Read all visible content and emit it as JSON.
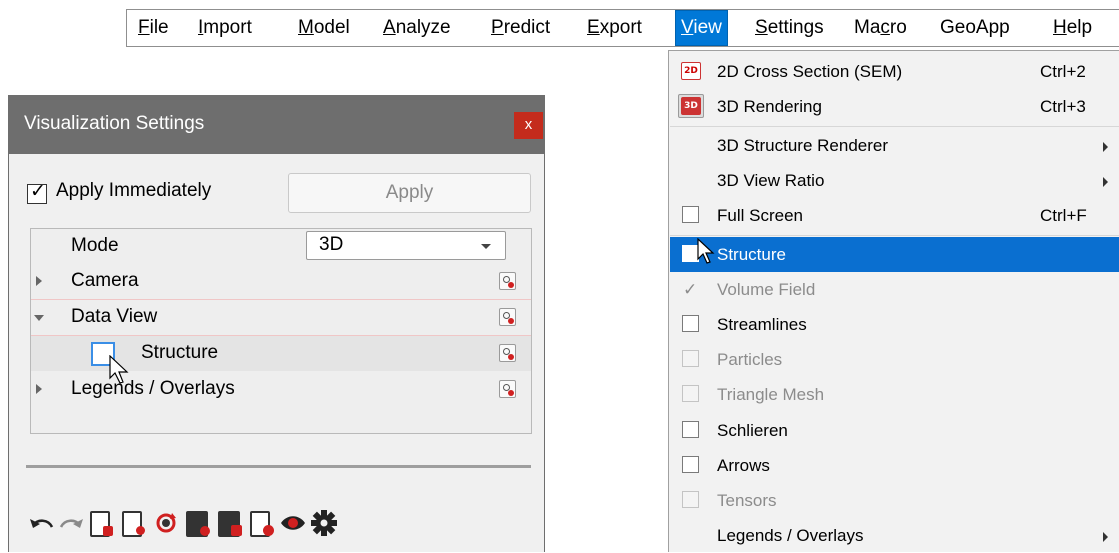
{
  "menubar": {
    "items": [
      {
        "label": "File",
        "mnemonic": "F"
      },
      {
        "label": "Import",
        "mnemonic": "I"
      },
      {
        "label": "Model",
        "mnemonic": "M"
      },
      {
        "label": "Analyze",
        "mnemonic": "A"
      },
      {
        "label": "Predict",
        "mnemonic": "P"
      },
      {
        "label": "Export",
        "mnemonic": "E"
      },
      {
        "label": "View",
        "mnemonic": "V",
        "active": true
      },
      {
        "label": "Settings",
        "mnemonic": "S"
      },
      {
        "label": "Macro",
        "mnemonic": "c"
      },
      {
        "label": "GeoApp",
        "mnemonic": ""
      },
      {
        "label": "Help",
        "mnemonic": "H"
      }
    ]
  },
  "view_menu": {
    "items": [
      {
        "label": "2D Cross Section (SEM)",
        "shortcut": "Ctrl+2",
        "icon": "2D"
      },
      {
        "label": "3D Rendering",
        "shortcut": "Ctrl+3",
        "icon": "3D"
      },
      {
        "label": "3D Structure Renderer",
        "submenu": true
      },
      {
        "label": "3D View Ratio",
        "submenu": true
      },
      {
        "label": "Full Screen",
        "shortcut": "Ctrl+F"
      },
      {
        "label": "Structure",
        "highlighted": true
      },
      {
        "label": "Volume Field",
        "checked": true,
        "disabled": true
      },
      {
        "label": "Streamlines"
      },
      {
        "label": "Particles",
        "disabled": true
      },
      {
        "label": "Triangle Mesh",
        "disabled": true
      },
      {
        "label": "Schlieren"
      },
      {
        "label": "Arrows"
      },
      {
        "label": "Tensors",
        "disabled": true
      },
      {
        "label": "Legends / Overlays",
        "submenu": true
      }
    ]
  },
  "panel": {
    "title": "Visualization Settings",
    "close": "x",
    "apply_immediately_label": "Apply Immediately",
    "apply_immediately_checked": true,
    "apply_button": "Apply",
    "tree": {
      "mode_label": "Mode",
      "mode_value": "3D",
      "camera_label": "Camera",
      "data_view_label": "Data View",
      "structure_label": "Structure",
      "legends_label": "Legends / Overlays"
    }
  },
  "colors": {
    "menu_highlight": "#0078d7",
    "panel_title_bg": "#6e6e6e",
    "close_red": "#c42b1c",
    "accent_red": "#d02020"
  }
}
